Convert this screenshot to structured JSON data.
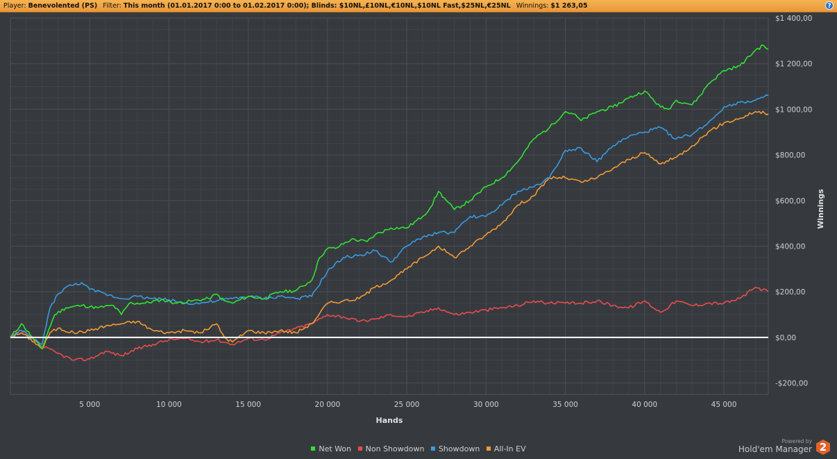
{
  "filter_bar": {
    "player_label": "Player:",
    "player_value": "Benevolented (PS)",
    "filter_label": "Filter:",
    "filter_value": "This month (01.01.2017 0:00 to 01.02.2017 0:00); Blinds: $10NL,£10NL,€10NL,$10NL Fast,$25NL,€25NL",
    "winnings_label": "Winnings:",
    "winnings_value": "$1 263,05",
    "help_label": "?"
  },
  "branding": {
    "powered_by": "Powered by",
    "name": "Hold'em Manager",
    "logo_text": "2"
  },
  "colors": {
    "net_won": "#33e133",
    "non_showdown": "#e84c4c",
    "showdown": "#3a9ae0",
    "all_in_ev": "#f39a33",
    "zero_line": "#ffffff",
    "grid": "#4a4f55",
    "background": "#363a3f"
  },
  "chart_data": {
    "type": "line",
    "title": "",
    "xlabel": "Hands",
    "ylabel": "Winnings",
    "xlim": [
      0,
      47800
    ],
    "ylim": [
      -250,
      1400
    ],
    "x_ticks": [
      5000,
      10000,
      15000,
      20000,
      25000,
      30000,
      35000,
      40000,
      45000
    ],
    "x_tick_labels": [
      "5 000",
      "10 000",
      "15 000",
      "20 000",
      "25 000",
      "30 000",
      "35 000",
      "40 000",
      "45 000"
    ],
    "y_ticks": [
      -200,
      0,
      200,
      400,
      600,
      800,
      1000,
      1200,
      1400
    ],
    "y_tick_labels": [
      "-$200,00",
      "$0,00",
      "$200,00",
      "$400,00",
      "$600,00",
      "$800,00",
      "$1 000,00",
      "$1 200,00",
      "$1 400,00"
    ],
    "grid": true,
    "legend_position": "bottom-center",
    "series": [
      {
        "name": "Net Won",
        "color": "#33e133",
        "x": [
          0,
          700,
          1500,
          2000,
          2400,
          2800,
          3500,
          4500,
          5500,
          6500,
          7000,
          7500,
          8500,
          9500,
          10500,
          11500,
          12500,
          13000,
          13500,
          14000,
          15000,
          16000,
          17000,
          18000,
          19000,
          19500,
          20000,
          20500,
          21500,
          22500,
          23000,
          24000,
          25000,
          26000,
          26500,
          27000,
          27500,
          28000,
          29000,
          30000,
          31000,
          32000,
          33000,
          34000,
          35000,
          35500,
          36000,
          37000,
          38000,
          39000,
          40000,
          41000,
          41500,
          42000,
          43000,
          43500,
          44000,
          45000,
          46000,
          47000,
          47500,
          47800
        ],
        "y": [
          0,
          60,
          -10,
          -50,
          30,
          100,
          130,
          140,
          130,
          140,
          100,
          150,
          150,
          165,
          150,
          160,
          170,
          190,
          160,
          150,
          180,
          170,
          200,
          205,
          250,
          350,
          390,
          390,
          430,
          420,
          450,
          480,
          480,
          530,
          570,
          640,
          600,
          560,
          600,
          660,
          700,
          770,
          870,
          920,
          990,
          980,
          950,
          990,
          1010,
          1050,
          1080,
          1010,
          1000,
          1040,
          1020,
          1060,
          1110,
          1170,
          1190,
          1260,
          1280,
          1263
        ]
      },
      {
        "name": "Non Showdown",
        "color": "#e84c4c",
        "x": [
          0,
          700,
          2000,
          3000,
          4000,
          5000,
          6000,
          7000,
          8000,
          9000,
          10000,
          11000,
          12000,
          13000,
          14000,
          15000,
          16000,
          17000,
          18000,
          19000,
          20000,
          21000,
          22000,
          23000,
          24000,
          25000,
          26000,
          27000,
          28000,
          29000,
          30000,
          31000,
          32000,
          33000,
          34000,
          35000,
          36000,
          37000,
          38000,
          39000,
          40000,
          41000,
          42000,
          43000,
          44000,
          45000,
          46000,
          47000,
          47800
        ],
        "y": [
          0,
          30,
          -40,
          -70,
          -100,
          -95,
          -60,
          -80,
          -50,
          -30,
          -10,
          -5,
          -20,
          -10,
          -30,
          -5,
          -10,
          20,
          40,
          60,
          100,
          90,
          70,
          80,
          100,
          90,
          110,
          130,
          100,
          110,
          120,
          130,
          140,
          160,
          150,
          150,
          150,
          160,
          140,
          130,
          160,
          110,
          160,
          140,
          150,
          150,
          170,
          220,
          200
        ]
      },
      {
        "name": "Showdown",
        "color": "#3a9ae0",
        "x": [
          0,
          700,
          1500,
          2000,
          2500,
          3000,
          3500,
          4500,
          5000,
          6000,
          7000,
          8000,
          9000,
          10000,
          11000,
          12000,
          13000,
          14000,
          15000,
          16000,
          17000,
          18000,
          19000,
          20000,
          21000,
          22000,
          23000,
          24000,
          25000,
          26000,
          27000,
          28000,
          29000,
          30000,
          31000,
          32000,
          33000,
          34000,
          35000,
          36000,
          37000,
          38000,
          39000,
          40000,
          41000,
          42000,
          43000,
          44000,
          45000,
          46000,
          47000,
          47800
        ],
        "y": [
          0,
          30,
          -10,
          -30,
          130,
          190,
          220,
          240,
          210,
          190,
          170,
          180,
          170,
          165,
          150,
          150,
          160,
          170,
          180,
          170,
          180,
          170,
          180,
          290,
          350,
          360,
          380,
          330,
          400,
          440,
          460,
          460,
          530,
          530,
          580,
          640,
          660,
          700,
          820,
          830,
          770,
          840,
          880,
          900,
          920,
          870,
          890,
          940,
          1010,
          1030,
          1040,
          1060
        ]
      },
      {
        "name": "All-In EV",
        "color": "#f39a33",
        "x": [
          0,
          700,
          1500,
          2000,
          2500,
          3000,
          4000,
          5000,
          6000,
          7000,
          8000,
          9000,
          10000,
          11000,
          12000,
          13000,
          13500,
          14000,
          15000,
          16000,
          17000,
          18000,
          19000,
          20000,
          21000,
          22000,
          23000,
          24000,
          25000,
          26000,
          27000,
          28000,
          29000,
          30000,
          31000,
          32000,
          33000,
          34000,
          35000,
          36000,
          37000,
          38000,
          39000,
          40000,
          41000,
          42000,
          43000,
          44000,
          45000,
          46000,
          47000,
          47800
        ],
        "y": [
          0,
          20,
          -20,
          -50,
          20,
          40,
          20,
          30,
          50,
          60,
          70,
          30,
          20,
          30,
          20,
          60,
          0,
          -20,
          30,
          20,
          30,
          20,
          60,
          150,
          160,
          170,
          220,
          250,
          300,
          350,
          400,
          350,
          400,
          450,
          500,
          580,
          620,
          700,
          700,
          680,
          700,
          740,
          780,
          810,
          760,
          790,
          840,
          900,
          940,
          960,
          990,
          980
        ]
      }
    ]
  }
}
